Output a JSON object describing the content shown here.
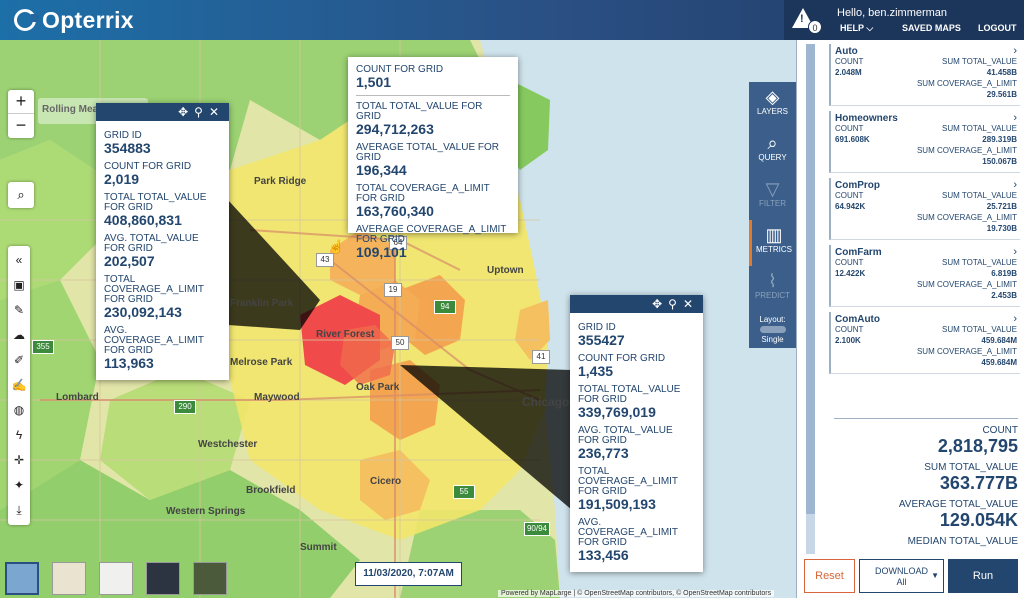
{
  "header": {
    "logo": "Opterrix",
    "alert_count": "0",
    "greeting": "Hello, ben.zimmerman",
    "help": "HELP ⌵",
    "saved_maps": "SAVED MAPS",
    "logout": "LOGOUT"
  },
  "map": {
    "place_labels": [
      "Park Ridge",
      "Melrose Park",
      "Maywood",
      "Oak Park",
      "Cicero",
      "Westchester",
      "Brookfield",
      "Western Springs",
      "Summit",
      "Lombard",
      "Uptown",
      "Chicago",
      "Franklin Park",
      "River Forest",
      "Rolling Meadows"
    ],
    "road_labels": [
      "43",
      "19",
      "64",
      "50",
      "290",
      "355",
      "94",
      "55",
      "90/94",
      "41"
    ],
    "date_badge": "11/03/2020, 7:07AM",
    "attribution": "Powered by MapLarge | © OpenStreetMap contributors, © OpenStreetMap contributors"
  },
  "popup_left": {
    "grid_id_label": "GRID ID",
    "grid_id": "354883",
    "count_label": "COUNT FOR GRID",
    "count": "2,019",
    "total_value_label": "TOTAL TOTAL_VALUE FOR GRID",
    "total_value": "408,860,831",
    "avg_value_label": "AVG. TOTAL_VALUE FOR GRID",
    "avg_value": "202,507",
    "total_cov_label": "TOTAL COVERAGE_A_LIMIT FOR GRID",
    "total_cov": "230,092,143",
    "avg_cov_label": "AVG. COVERAGE_A_LIMIT FOR GRID",
    "avg_cov": "113,963"
  },
  "popup_top": {
    "count_label": "COUNT FOR GRID",
    "count": "1,501",
    "total_value_label": "TOTAL TOTAL_VALUE FOR GRID",
    "total_value": "294,712,263",
    "avg_value_label": "AVERAGE TOTAL_VALUE FOR GRID",
    "avg_value": "196,344",
    "total_cov_label": "TOTAL COVERAGE_A_LIMIT FOR GRID",
    "total_cov": "163,760,340",
    "avg_cov_label": "AVERAGE COVERAGE_A_LIMIT FOR GRID",
    "avg_cov": "109,101"
  },
  "popup_right": {
    "grid_id_label": "GRID ID",
    "grid_id": "355427",
    "count_label": "COUNT FOR GRID",
    "count": "1,435",
    "total_value_label": "TOTAL TOTAL_VALUE FOR GRID",
    "total_value": "339,769,019",
    "avg_value_label": "AVG. TOTAL_VALUE FOR GRID",
    "avg_value": "236,773",
    "total_cov_label": "TOTAL COVERAGE_A_LIMIT FOR GRID",
    "total_cov": "191,509,193",
    "avg_cov_label": "AVG. COVERAGE_A_LIMIT FOR GRID",
    "avg_cov": "133,456"
  },
  "sidetools": {
    "layers": "LAYERS",
    "query": "QUERY",
    "filter": "FILTER",
    "metrics": "METRICS",
    "predict": "PREDICT",
    "layout_label": "Layout:",
    "layout_value": "Single"
  },
  "panel": {
    "cards": [
      {
        "title": "Auto",
        "count_label": "COUNT",
        "count": "2.048M",
        "sum_value_label": "SUM TOTAL_VALUE",
        "sum_value": "41.458B",
        "sum_cov_label": "SUM COVERAGE_A_LIMIT",
        "sum_cov": "29.561B"
      },
      {
        "title": "Homeowners",
        "count_label": "COUNT",
        "count": "691.608K",
        "sum_value_label": "SUM TOTAL_VALUE",
        "sum_value": "289.319B",
        "sum_cov_label": "SUM COVERAGE_A_LIMIT",
        "sum_cov": "150.067B"
      },
      {
        "title": "ComProp",
        "count_label": "COUNT",
        "count": "64.942K",
        "sum_value_label": "SUM TOTAL_VALUE",
        "sum_value": "25.721B",
        "sum_cov_label": "SUM COVERAGE_A_LIMIT",
        "sum_cov": "19.730B"
      },
      {
        "title": "ComFarm",
        "count_label": "COUNT",
        "count": "12.422K",
        "sum_value_label": "SUM TOTAL_VALUE",
        "sum_value": "6.819B",
        "sum_cov_label": "SUM COVERAGE_A_LIMIT",
        "sum_cov": "2.453B"
      },
      {
        "title": "ComAuto",
        "count_label": "COUNT",
        "count": "2.100K",
        "sum_value_label": "SUM TOTAL_VALUE",
        "sum_value": "459.684M",
        "sum_cov_label": "SUM COVERAGE_A_LIMIT",
        "sum_cov": "459.684M"
      }
    ],
    "totals": {
      "count_label": "COUNT",
      "count": "2,818,795",
      "sum_label": "SUM TOTAL_VALUE",
      "sum": "363.777B",
      "avg_label": "AVERAGE TOTAL_VALUE",
      "avg": "129.054K",
      "median_label": "MEDIAN TOTAL_VALUE"
    }
  },
  "footer": {
    "reset": "Reset",
    "download": "DOWNLOAD",
    "download_sub": "All",
    "run": "Run"
  }
}
